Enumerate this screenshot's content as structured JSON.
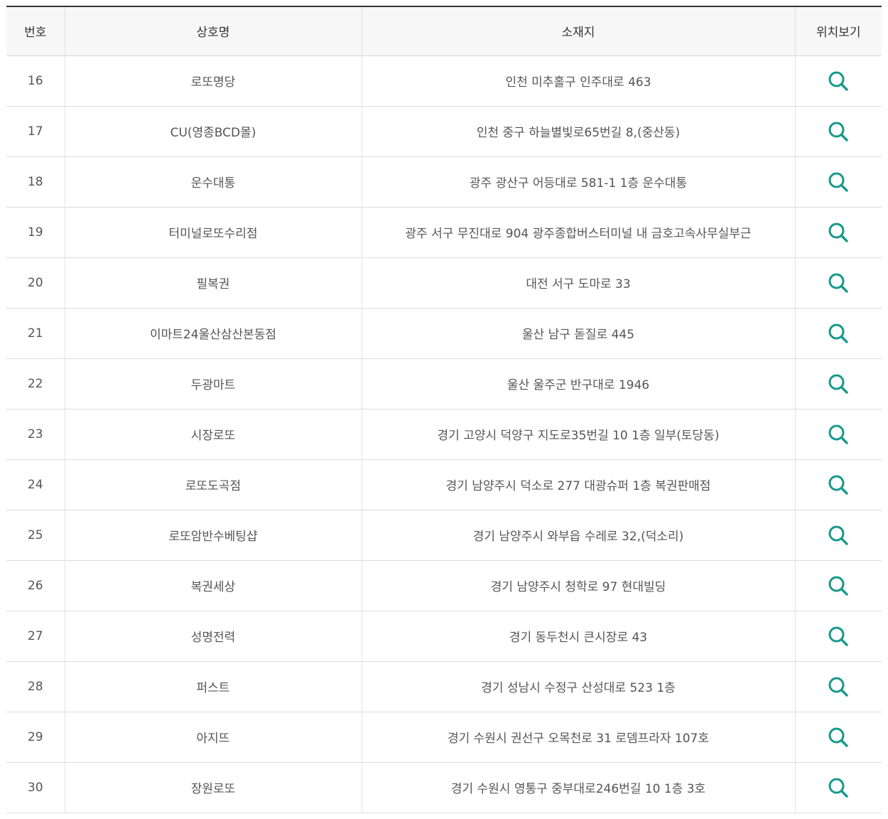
{
  "table": {
    "headers": {
      "no": "번호",
      "name": "상호명",
      "address": "소재지",
      "map": "위치보기"
    },
    "rows": [
      {
        "no": "16",
        "name": "로또명당",
        "address": "인천 미추홀구 인주대로 463"
      },
      {
        "no": "17",
        "name": "CU(영종BCD몰)",
        "address": "인천 중구 하늘별빛로65번길 8,(중산동)"
      },
      {
        "no": "18",
        "name": "운수대통",
        "address": "광주 광산구 어등대로 581-1 1층 운수대통"
      },
      {
        "no": "19",
        "name": "터미널로또수리점",
        "address": "광주 서구 무진대로 904 광주종합버스터미널 내 금호고속사무실부근"
      },
      {
        "no": "20",
        "name": "필복권",
        "address": "대전 서구 도마로 33"
      },
      {
        "no": "21",
        "name": "이마트24울산삼산본동점",
        "address": "울산 남구 돋질로 445"
      },
      {
        "no": "22",
        "name": "두광마트",
        "address": "울산 울주군 반구대로 1946"
      },
      {
        "no": "23",
        "name": "시장로또",
        "address": "경기 고양시 덕양구 지도로35번길 10 1층 일부(토당동)"
      },
      {
        "no": "24",
        "name": "로또도곡점",
        "address": "경기 남양주시 덕소로 277 대광슈퍼 1층 복권판매점"
      },
      {
        "no": "25",
        "name": "로또암반수베팅샵",
        "address": "경기 남양주시 와부읍 수레로 32,(덕소리)"
      },
      {
        "no": "26",
        "name": "복권세상",
        "address": "경기 남양주시 청학로 97 현대빌딩"
      },
      {
        "no": "27",
        "name": "성명전력",
        "address": "경기 동두천시 큰시장로 43"
      },
      {
        "no": "28",
        "name": "퍼스트",
        "address": "경기 성남시 수정구 산성대로 523 1층"
      },
      {
        "no": "29",
        "name": "아지뜨",
        "address": "경기 수원시 권선구 오목천로 31 로뎀프라자 107호"
      },
      {
        "no": "30",
        "name": "장원로또",
        "address": "경기 수원시 영통구 중부대로246번길 10 1층 3호"
      }
    ]
  },
  "icons": {
    "map": "search-icon"
  },
  "colors": {
    "accent": "#16998b",
    "header_bg": "#f7f7f7",
    "top_border": "#333333"
  }
}
